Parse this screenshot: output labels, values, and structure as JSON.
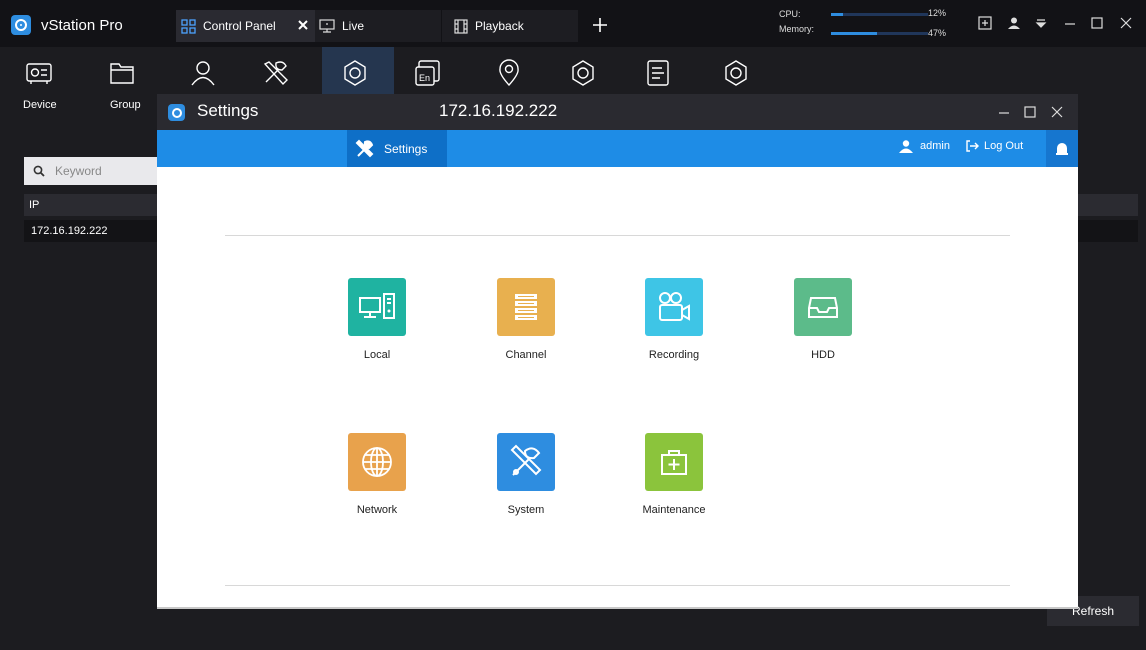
{
  "app": {
    "name": "vStation Pro",
    "accent": "#2e8de0"
  },
  "tabs": [
    {
      "label": "Control Panel",
      "icon": "grid-icon",
      "active": true
    },
    {
      "label": "Live",
      "icon": "monitor-icon",
      "active": false
    },
    {
      "label": "Playback",
      "icon": "film-icon",
      "active": false
    }
  ],
  "system": {
    "cpu_label": "CPU:",
    "cpu_percent": "12%",
    "cpu_value": 0.12,
    "memory_label": "Memory:",
    "memory_percent": "47%",
    "memory_value": 0.47
  },
  "toolbar": {
    "device_label": "Device",
    "group_label": "Group"
  },
  "sidebar": {
    "search_placeholder": "Keyword"
  },
  "device_table": {
    "column_ip": "IP",
    "rows": [
      {
        "ip": "172.16.192.222"
      }
    ]
  },
  "refresh_label": "Refresh",
  "settings_window": {
    "title": "Settings",
    "ip": "172.16.192.222",
    "nav_tab": "Settings",
    "user": "admin",
    "logout": "Log Out",
    "items": [
      {
        "label": "Local",
        "icon": "computer-icon",
        "color": "#1fb3a1"
      },
      {
        "label": "Channel",
        "icon": "channel-icon",
        "color": "#e8b04f"
      },
      {
        "label": "Recording",
        "icon": "camera-icon",
        "color": "#3ec5e6"
      },
      {
        "label": "HDD",
        "icon": "hdd-icon",
        "color": "#5cbb8a"
      },
      {
        "label": "Network",
        "icon": "globe-icon",
        "color": "#e8a24c"
      },
      {
        "label": "System",
        "icon": "tools-icon",
        "color": "#2e8de0"
      },
      {
        "label": "Maintenance",
        "icon": "toolbox-icon",
        "color": "#8bc43c"
      }
    ]
  }
}
